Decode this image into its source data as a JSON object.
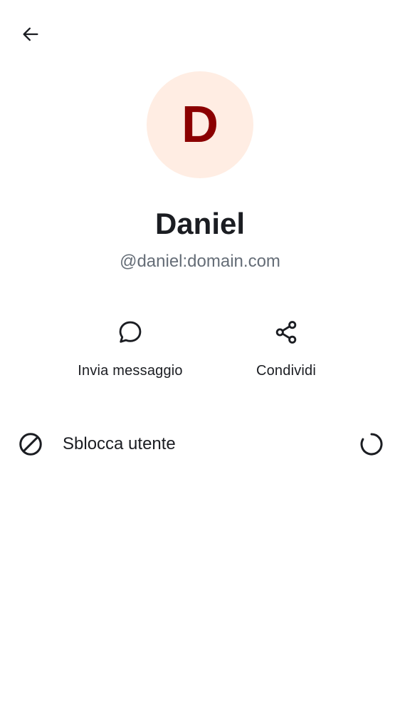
{
  "header": {
    "back_icon": "arrow-left-icon"
  },
  "profile": {
    "avatar_initial": "D",
    "avatar_bg_color": "#ffede3",
    "avatar_text_color": "#8b0000",
    "display_name": "Daniel",
    "user_id": "@daniel:domain.com"
  },
  "actions": [
    {
      "label": "Invia messaggio",
      "icon": "chat-bubble-icon"
    },
    {
      "label": "Condividi",
      "icon": "share-icon"
    }
  ],
  "list": {
    "unblock": {
      "label": "Sblocca utente",
      "icon": "block-icon",
      "status_icon": "loading-spinner-icon"
    }
  }
}
